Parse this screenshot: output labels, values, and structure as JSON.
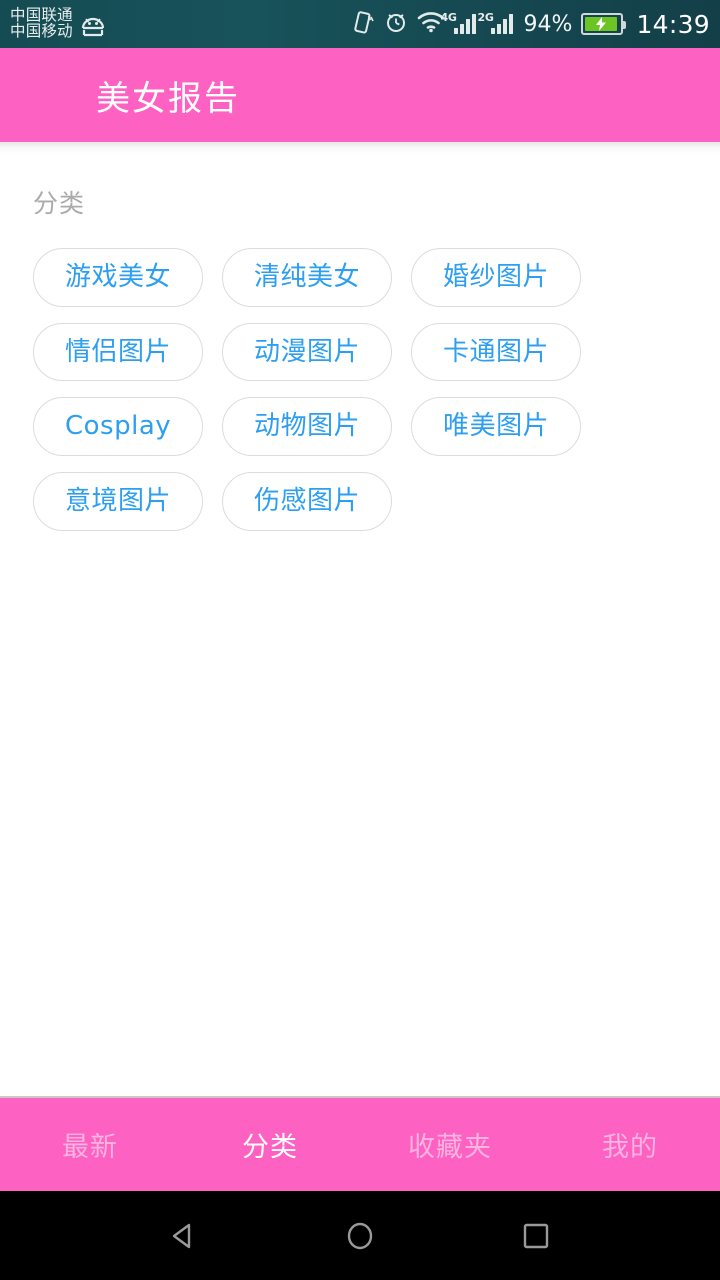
{
  "status_bar": {
    "carrier_primary": "中国联通",
    "carrier_secondary": "中国移动",
    "android_icon": "android-robot-icon",
    "vibrate_icon": "vibrate-icon",
    "alarm_icon": "alarm-clock-icon",
    "wifi_icon": "wifi-icon",
    "signal_1_label": "4G",
    "signal_2_label": "2G",
    "battery_percent": "94%",
    "battery_level": 94,
    "battery_charging": true,
    "battery_color": "#6cc425",
    "time": "14:39",
    "background_color": "#154c54"
  },
  "header": {
    "title": "美女报告",
    "background_color": "#fd61c2",
    "text_color": "#ffffff"
  },
  "content": {
    "section_label": "分类",
    "section_label_color": "#ababab",
    "chip_text_color": "#2e9ff0",
    "chip_border_color": "#dcdcdc",
    "categories": [
      {
        "label": "游戏美女"
      },
      {
        "label": "清纯美女"
      },
      {
        "label": "婚纱图片"
      },
      {
        "label": "情侣图片"
      },
      {
        "label": "动漫图片"
      },
      {
        "label": "卡通图片"
      },
      {
        "label": "Cosplay"
      },
      {
        "label": "动物图片"
      },
      {
        "label": "唯美图片"
      },
      {
        "label": "意境图片"
      },
      {
        "label": "伤感图片"
      }
    ]
  },
  "bottom_nav": {
    "background_color": "#fd61c2",
    "active_color": "#ffffff",
    "inactive_color": "#ffb3e0",
    "items": [
      {
        "label": "最新",
        "active": false
      },
      {
        "label": "分类",
        "active": true
      },
      {
        "label": "收藏夹",
        "active": false
      },
      {
        "label": "我的",
        "active": false
      }
    ]
  },
  "system_bar": {
    "back_icon": "back-triangle-icon",
    "home_icon": "home-circle-icon",
    "recents_icon": "recents-square-icon",
    "background_color": "#000000"
  }
}
